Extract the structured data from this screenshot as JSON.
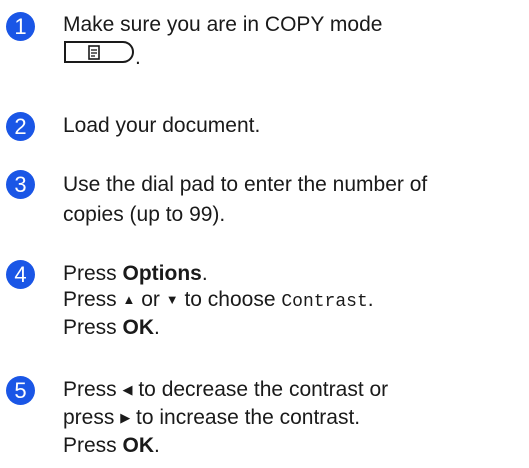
{
  "steps": [
    {
      "number": "1",
      "line1": "Make sure you are in COPY mode",
      "line2_after": "."
    },
    {
      "number": "2",
      "line1": "Load your document."
    },
    {
      "number": "3",
      "line1": "Use the dial pad to enter the number of",
      "line2": "copies (up to 99)."
    },
    {
      "number": "4",
      "press": "Press ",
      "options": "Options",
      "dot": ".",
      "press_up": "Press ",
      "up_arrow": "▲",
      "or": " or ",
      "down_arrow": "▼",
      "to_choose": " to choose ",
      "contrast_setting": "Contrast",
      "press_ok": "Press ",
      "ok": "OK"
    },
    {
      "number": "5",
      "press": "Press ",
      "left_arrow": "◀",
      "decrease": " to decrease the contrast or",
      "press_lower": "press ",
      "right_arrow": "▶",
      "increase": " to increase the contrast.",
      "press_ok": "Press ",
      "ok": "OK"
    }
  ],
  "icons": {
    "copy_mode_key": "copy-mode-key-icon"
  },
  "colors": {
    "step_badge": "#1a56e6"
  }
}
